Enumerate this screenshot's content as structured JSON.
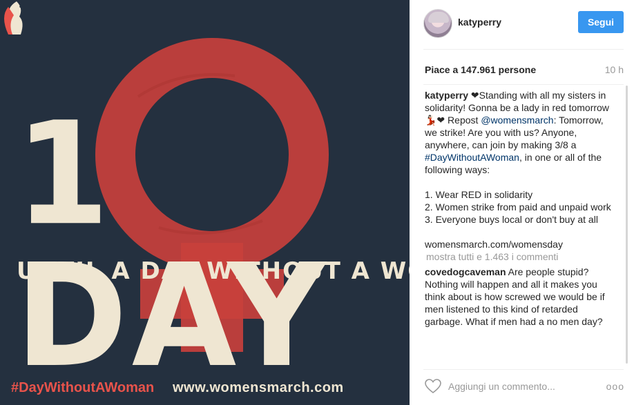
{
  "post_image": {
    "headline": "1 DAY",
    "subline": "UNTIL A DAY WITHOUT A WOMAN",
    "hashtag": "#DayWithoutAWoman",
    "site": "www.womensmarch.com",
    "colors": {
      "background": "#24303f",
      "symbol": "#c8403c",
      "text": "#efe6d2",
      "hashtag": "#e8534b"
    }
  },
  "header": {
    "username": "katyperry",
    "follow_label": "Segui"
  },
  "stats": {
    "likes": "Piace a 147.961 persone",
    "time": "10 h"
  },
  "caption": {
    "user": "katyperry",
    "part1": " ❤Standing with all my sisters in solidarity! Gonna be a lady in red tomorrow 💃🏻❤ Repost ",
    "mention": "@womensmarch",
    "part2": ": Tomorrow, we strike! Are you with us? Anyone, anywhere, can join by making 3/8 a ",
    "hashtag": "#DayWithoutAWoman",
    "part3": ", in one or all of the following ways:\n\n1. Wear RED in solidarity\n2. Women strike from paid and unpaid work\n3. Everyone buys local or don't buy at all\n\nwomensmarch.com/womensday"
  },
  "show_all_comments": "mostra tutti e 1.463 i commenti",
  "comments": [
    {
      "user": "covedogcaveman",
      "text": " Are people stupid? Nothing will happen and all it makes you think about is how screwed we would be if men listened to this kind of retarded garbage. What if men had a no men day?"
    }
  ],
  "footer": {
    "comment_placeholder": "Aggiungi un commento...",
    "more": "ooo",
    "accent": "#3897f0"
  }
}
